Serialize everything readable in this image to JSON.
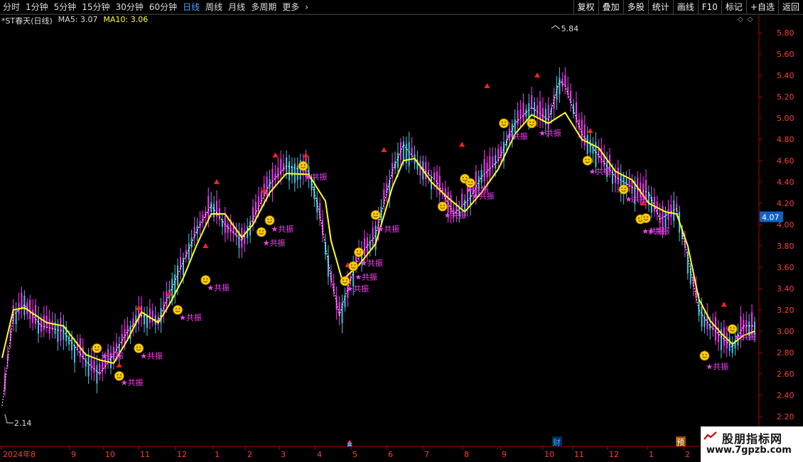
{
  "periods": [
    {
      "label": "分时",
      "active": false
    },
    {
      "label": "1分钟",
      "active": false
    },
    {
      "label": "5分钟",
      "active": false
    },
    {
      "label": "15分钟",
      "active": false
    },
    {
      "label": "30分钟",
      "active": false
    },
    {
      "label": "60分钟",
      "active": false
    },
    {
      "label": "日线",
      "active": true
    },
    {
      "label": "周线",
      "active": false
    },
    {
      "label": "月线",
      "active": false
    },
    {
      "label": "多周期",
      "active": false
    },
    {
      "label": "更多",
      "active": false
    }
  ],
  "more_icon": "chevron-right-icon",
  "tools": [
    "复权",
    "叠加",
    "多股",
    "统计",
    "画线",
    "F10",
    "标记",
    "+自选",
    "返回"
  ],
  "legend": {
    "stock": "*ST春天(日线)",
    "ma5": "MA5: 3.07",
    "ma10": "MA10: 3.06"
  },
  "markers": {
    "badge": "预",
    "fin": "财",
    "resonance": "★共振"
  },
  "watermark": {
    "name": "股朋指标网",
    "url": "www.7gpzb.com"
  },
  "colors": {
    "up": "#ff33ff",
    "down": "#40c8e0",
    "ma10": "#ffff22",
    "axis": "#b00000",
    "axis_text": "#ff3b3b",
    "smile": "#ffd000",
    "signal": "#ff40ff",
    "arrow": "#ff2020"
  },
  "chart_data": {
    "type": "candlestick",
    "ylim": [
      2.1,
      5.95
    ],
    "yticks": [
      2.2,
      2.4,
      2.6,
      2.8,
      3.0,
      3.2,
      3.4,
      3.6,
      3.8,
      4.0,
      4.2,
      4.4,
      4.6,
      4.8,
      5.0,
      5.2,
      5.4,
      5.6,
      5.8
    ],
    "current_price": "4.07",
    "high_label": "5.84",
    "low_label": "2.14",
    "xticks": [
      "2024年8",
      "9",
      "10",
      "11",
      "12",
      "1",
      "2",
      "3",
      "4",
      "5",
      "6",
      "7",
      "8",
      "9",
      "10",
      "11",
      "12",
      "1",
      "2"
    ],
    "ma10_anchors": [
      [
        0,
        2.75
      ],
      [
        4,
        3.2
      ],
      [
        8,
        3.22
      ],
      [
        16,
        3.08
      ],
      [
        22,
        3.05
      ],
      [
        30,
        2.78
      ],
      [
        35,
        2.73
      ],
      [
        40,
        2.7
      ],
      [
        45,
        2.92
      ],
      [
        50,
        3.18
      ],
      [
        56,
        3.08
      ],
      [
        60,
        3.25
      ],
      [
        65,
        3.5
      ],
      [
        70,
        3.82
      ],
      [
        75,
        4.1
      ],
      [
        80,
        4.1
      ],
      [
        86,
        3.88
      ],
      [
        90,
        4.0
      ],
      [
        96,
        4.3
      ],
      [
        102,
        4.48
      ],
      [
        110,
        4.47
      ],
      [
        116,
        4.22
      ],
      [
        118,
        3.85
      ],
      [
        122,
        3.48
      ],
      [
        128,
        3.62
      ],
      [
        134,
        3.82
      ],
      [
        140,
        4.35
      ],
      [
        144,
        4.6
      ],
      [
        148,
        4.62
      ],
      [
        154,
        4.4
      ],
      [
        160,
        4.25
      ],
      [
        166,
        4.12
      ],
      [
        172,
        4.3
      ],
      [
        178,
        4.52
      ],
      [
        184,
        4.85
      ],
      [
        190,
        5.03
      ],
      [
        196,
        4.95
      ],
      [
        202,
        5.05
      ],
      [
        208,
        4.8
      ],
      [
        214,
        4.72
      ],
      [
        220,
        4.5
      ],
      [
        226,
        4.42
      ],
      [
        232,
        4.2
      ],
      [
        238,
        4.12
      ],
      [
        242,
        4.1
      ],
      [
        246,
        3.8
      ],
      [
        250,
        3.3
      ],
      [
        254,
        3.1
      ],
      [
        258,
        2.98
      ],
      [
        262,
        2.88
      ],
      [
        266,
        2.96
      ],
      [
        270,
        3.0
      ]
    ],
    "ma5_anchors": [
      [
        0,
        2.3
      ],
      [
        4,
        3.15
      ],
      [
        8,
        3.25
      ],
      [
        14,
        3.05
      ],
      [
        22,
        3.0
      ],
      [
        30,
        2.72
      ],
      [
        35,
        2.6
      ],
      [
        40,
        2.78
      ],
      [
        45,
        3.0
      ],
      [
        50,
        3.15
      ],
      [
        56,
        3.1
      ],
      [
        60,
        3.35
      ],
      [
        65,
        3.65
      ],
      [
        70,
        3.95
      ],
      [
        75,
        4.18
      ],
      [
        80,
        4.0
      ],
      [
        86,
        3.85
      ],
      [
        90,
        4.05
      ],
      [
        96,
        4.38
      ],
      [
        102,
        4.55
      ],
      [
        110,
        4.5
      ],
      [
        114,
        4.1
      ],
      [
        118,
        3.5
      ],
      [
        121,
        3.15
      ],
      [
        124,
        3.4
      ],
      [
        128,
        3.7
      ],
      [
        134,
        3.9
      ],
      [
        140,
        4.5
      ],
      [
        144,
        4.75
      ],
      [
        150,
        4.55
      ],
      [
        156,
        4.4
      ],
      [
        162,
        4.1
      ],
      [
        168,
        4.25
      ],
      [
        172,
        4.45
      ],
      [
        178,
        4.6
      ],
      [
        184,
        4.95
      ],
      [
        190,
        5.1
      ],
      [
        196,
        4.98
      ],
      [
        200,
        5.35
      ],
      [
        202,
        5.3
      ],
      [
        208,
        4.85
      ],
      [
        214,
        4.65
      ],
      [
        220,
        4.45
      ],
      [
        226,
        4.35
      ],
      [
        232,
        4.3
      ],
      [
        236,
        4.05
      ],
      [
        242,
        4.15
      ],
      [
        246,
        3.7
      ],
      [
        250,
        3.2
      ],
      [
        254,
        3.05
      ],
      [
        258,
        2.95
      ],
      [
        262,
        2.85
      ],
      [
        266,
        3.05
      ],
      [
        270,
        3.05
      ]
    ],
    "smile_points": [
      [
        34,
        2.84
      ],
      [
        42,
        2.58
      ],
      [
        49,
        2.84
      ],
      [
        63,
        3.2
      ],
      [
        73,
        3.48
      ],
      [
        93,
        3.93
      ],
      [
        96,
        4.04
      ],
      [
        108,
        4.55
      ],
      [
        123,
        3.47
      ],
      [
        126,
        3.61
      ],
      [
        128,
        3.74
      ],
      [
        134,
        4.09
      ],
      [
        158,
        4.17
      ],
      [
        166,
        4.43
      ],
      [
        168,
        4.39
      ],
      [
        180,
        4.95
      ],
      [
        190,
        4.95
      ],
      [
        210,
        4.6
      ],
      [
        223,
        4.33
      ],
      [
        229,
        4.05
      ],
      [
        231,
        4.06
      ],
      [
        252,
        2.77
      ],
      [
        262,
        3.02
      ]
    ],
    "resonance_points": [
      [
        35,
        2.77
      ],
      [
        42,
        2.52
      ],
      [
        49,
        2.77
      ],
      [
        63,
        3.13
      ],
      [
        73,
        3.41
      ],
      [
        93,
        3.83
      ],
      [
        96,
        3.96
      ],
      [
        108,
        4.45
      ],
      [
        123,
        3.4
      ],
      [
        126,
        3.51
      ],
      [
        128,
        3.64
      ],
      [
        134,
        3.96
      ],
      [
        158,
        4.09
      ],
      [
        166,
        4.33
      ],
      [
        168,
        4.27
      ],
      [
        180,
        4.83
      ],
      [
        192,
        4.86
      ],
      [
        210,
        4.5
      ],
      [
        223,
        4.24
      ],
      [
        229,
        3.94
      ],
      [
        231,
        3.94
      ],
      [
        252,
        2.67
      ],
      [
        262,
        2.95
      ]
    ],
    "arrow_points": [
      [
        42,
        2.68
      ],
      [
        49,
        3.22
      ],
      [
        60,
        3.35
      ],
      [
        73,
        3.8
      ],
      [
        77,
        4.4
      ],
      [
        94,
        4.32
      ],
      [
        98,
        4.65
      ],
      [
        109,
        4.65
      ],
      [
        124,
        3.62
      ],
      [
        128,
        3.72
      ],
      [
        137,
        4.7
      ],
      [
        165,
        4.75
      ],
      [
        174,
        5.3
      ],
      [
        192,
        5.4
      ],
      [
        211,
        4.88
      ],
      [
        230,
        4.2
      ],
      [
        252,
        2.8
      ],
      [
        259,
        3.25
      ]
    ]
  }
}
